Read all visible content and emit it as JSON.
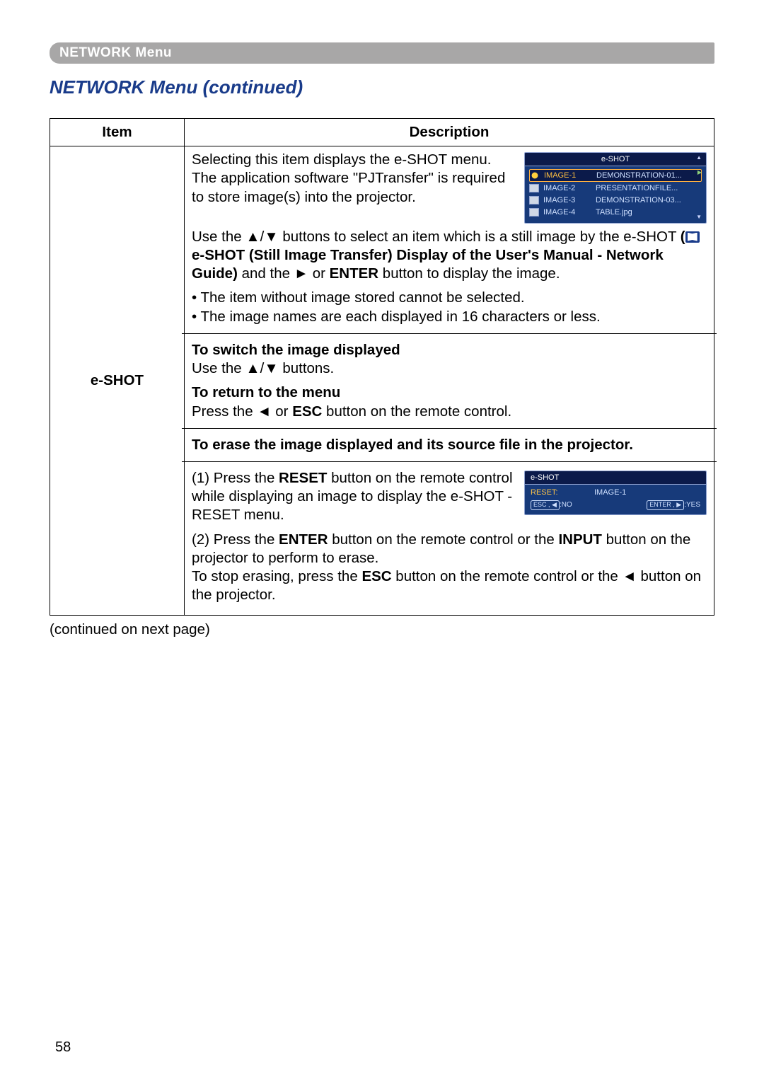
{
  "header": {
    "breadcrumb": "NETWORK Menu"
  },
  "title": "NETWORK Menu (continued)",
  "table": {
    "headers": {
      "item": "Item",
      "description": "Description"
    },
    "item_label": "e-SHOT"
  },
  "desc": {
    "p1a": "Selecting this item displays the e-SHOT menu.",
    "p1b": "The application software \"PJTransfer\" is required to store image(s) into the projector.",
    "p1c_pre": "Use the ▲/▼ buttons to select an item which is a still image by the e-SHOT ",
    "p1c_bold1_a": "(",
    "p1c_bold1_b": " e-SHOT (Still Image Transfer) Display of the User's Manual - Network Guide)",
    "p1c_mid": " and the ► or ",
    "p1c_enter": "ENTER",
    "p1c_tail": " button to display the image.",
    "bul1": "• The item without image stored cannot be selected.",
    "bul2": "• The image names are each displayed in 16 characters or less.",
    "h_switch": "To switch the image displayed",
    "p_switch": "Use the ▲/▼ buttons.",
    "h_return": "To return to the menu",
    "p_return_a": "Press the ◄ or ",
    "p_return_esc": "ESC",
    "p_return_b": " button on the remote control.",
    "h_erase": "To erase the image displayed and its source file in the projector.",
    "step1_a": "(1) Press the ",
    "step1_reset": "RESET",
    "step1_b": " button on the remote control while displaying an image to display the e-SHOT - RESET menu.",
    "step2_a": "(2) Press the ",
    "step2_enter": "ENTER",
    "step2_b": " button on the remote control or the ",
    "step2_input": "INPUT",
    "step2_c": " button on the projector to perform to erase.",
    "step2_d": "To stop erasing, press the ",
    "step2_esc": "ESC",
    "step2_e": " button on the remote control or the ◄ button on the projector."
  },
  "osd1": {
    "title": "e-SHOT",
    "rows": [
      {
        "a": "IMAGE-1",
        "b": "DEMONSTRATION-01..."
      },
      {
        "a": "IMAGE-2",
        "b": "PRESENTATIONFILE..."
      },
      {
        "a": "IMAGE-3",
        "b": "DEMONSTRATION-03..."
      },
      {
        "a": "IMAGE-4",
        "b": "TABLE.jpg"
      }
    ]
  },
  "osd2": {
    "title": "e-SHOT",
    "reset_label": "RESET:",
    "reset_value": "IMAGE-1",
    "no": {
      "key": "ESC , ◀",
      "txt": ":NO"
    },
    "yes": {
      "key": "ENTER , ▶",
      "txt": ":YES"
    }
  },
  "continued": "(continued on next page)",
  "page": "58"
}
